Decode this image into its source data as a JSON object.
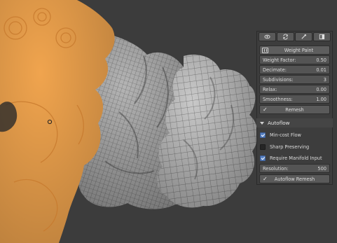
{
  "viewport": {
    "colors": {
      "background": "#3c3c3c",
      "selected_mesh": "#f0a44e",
      "wire_mesh": "#b9b9b9"
    }
  },
  "panel": {
    "tabs": [
      {
        "icon": "eye-icon"
      },
      {
        "icon": "refresh-icon"
      },
      {
        "icon": "eyedropper-icon"
      },
      {
        "icon": "layout-icon"
      }
    ],
    "weight_paint": {
      "title": "Weight Paint",
      "weight_factor": {
        "label": "Weight Factor:",
        "value": "0.50"
      },
      "decimate": {
        "label": "Decimate:",
        "value": "0.01"
      },
      "subdivisions": {
        "label": "Subdivisions:",
        "value": "3"
      },
      "relax": {
        "label": "Relax:",
        "value": "0.00"
      },
      "smoothness": {
        "label": "Smoothness:",
        "value": "1.00"
      },
      "remesh_label": "Remesh"
    },
    "autoflow": {
      "title": "Autoflow",
      "min_cost_flow": {
        "label": "Min-cost Flow",
        "checked": true
      },
      "sharp_preserving": {
        "label": "Sharp Preserving",
        "checked": false
      },
      "require_manifold": {
        "label": "Require Manifold Input",
        "checked": true
      },
      "resolution": {
        "label": "Resolution:",
        "value": "500"
      },
      "remesh_label": "Autoflow Remesh"
    },
    "colors": {
      "panel_bg": "#3d3d3d",
      "field": "#545454",
      "checkbox_on": "#5680c2"
    }
  }
}
